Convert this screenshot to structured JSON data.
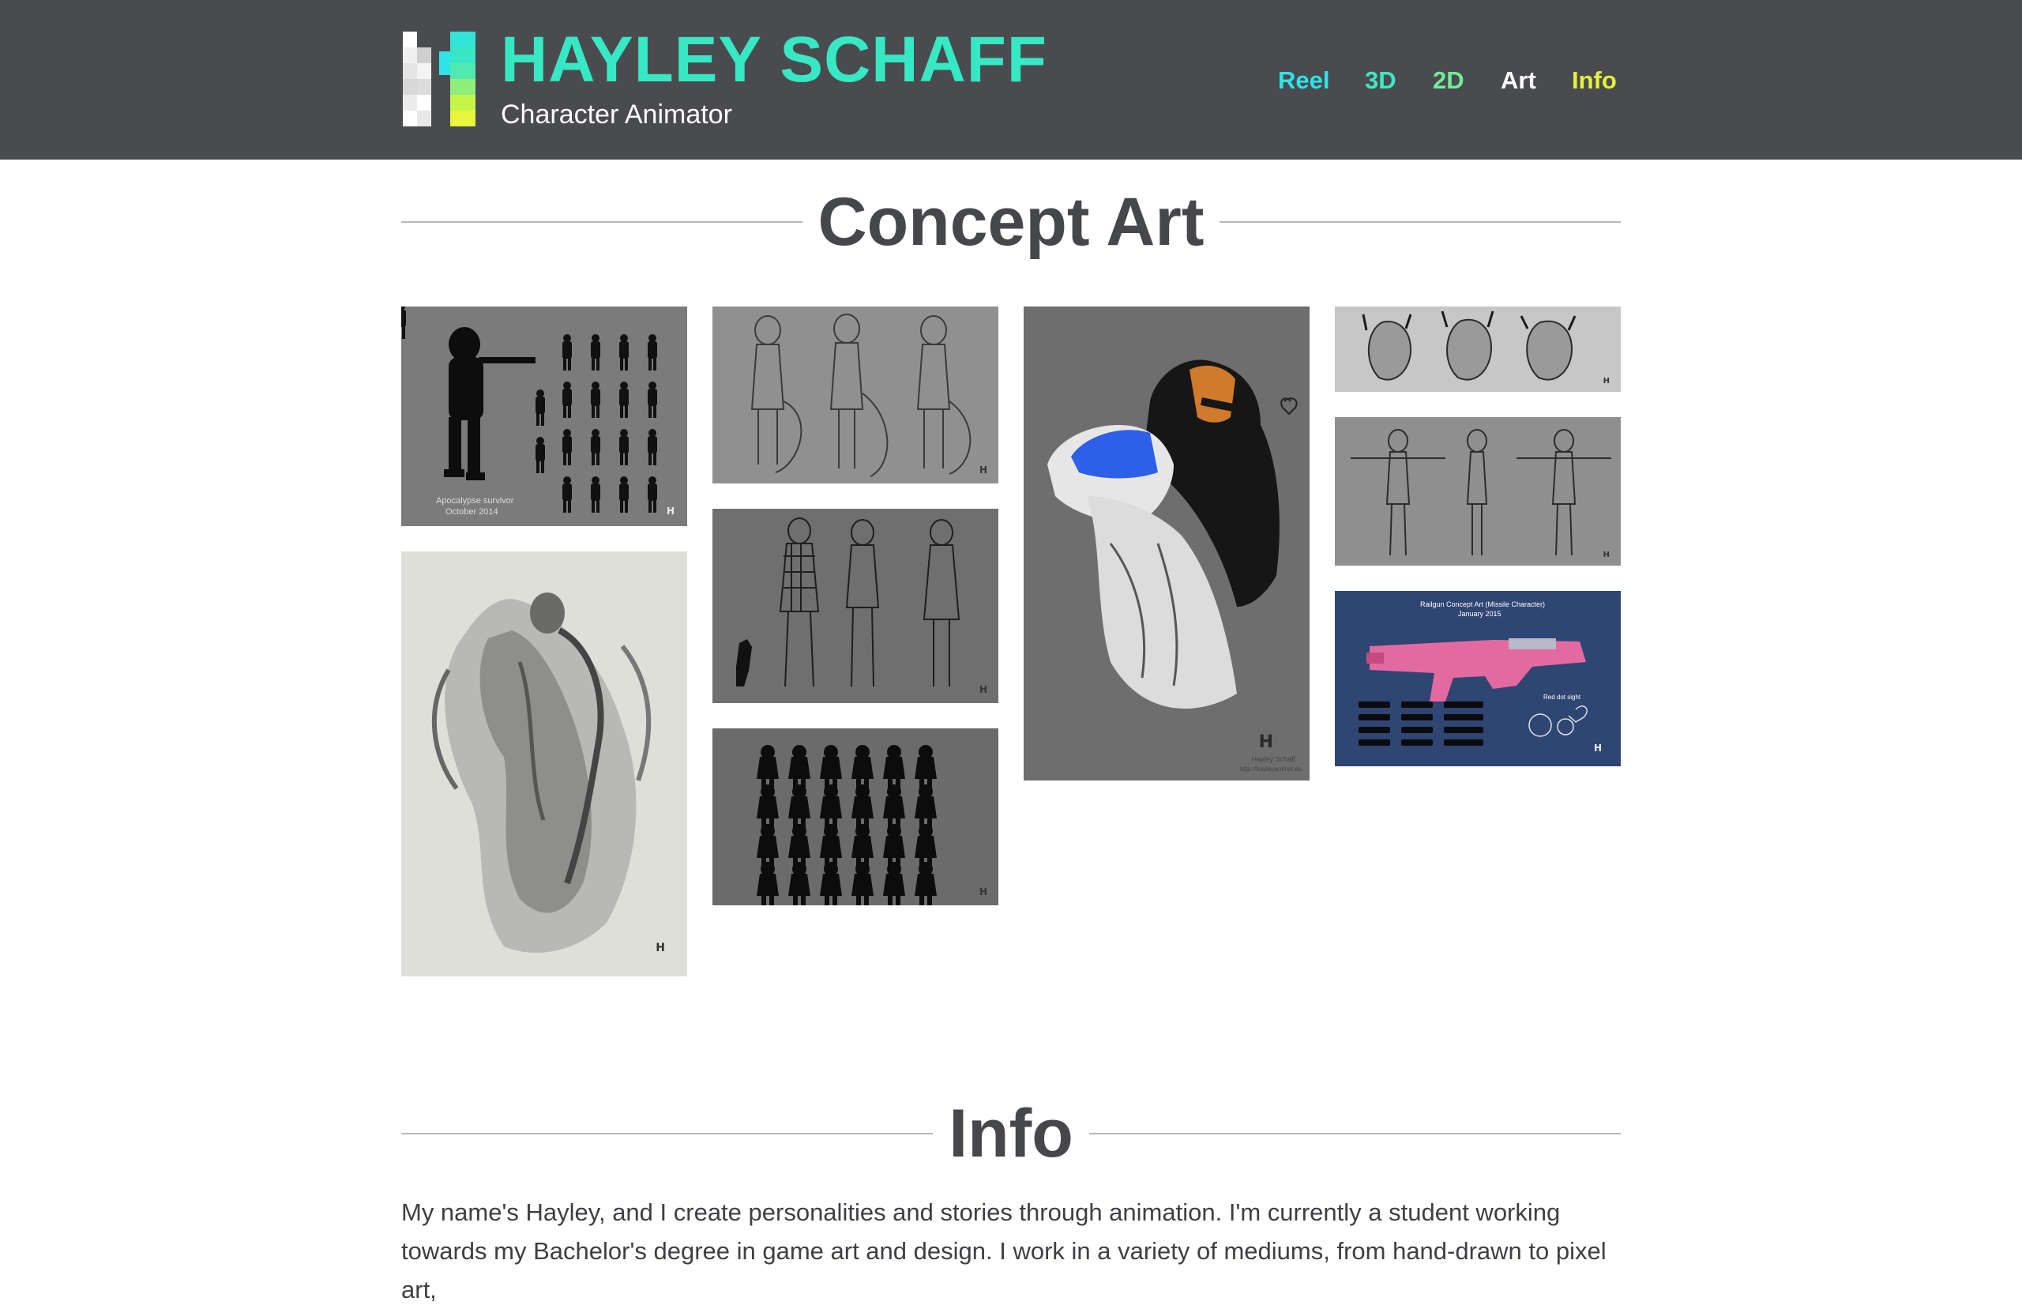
{
  "header": {
    "brand_name": "HAYLEY SCHAFF",
    "subtitle": "Character Animator",
    "nav": [
      {
        "label": "Reel",
        "color": "#2fe3e8"
      },
      {
        "label": "3D",
        "color": "#3fe7c2"
      },
      {
        "label": "2D",
        "color": "#72ec9a"
      },
      {
        "label": "Art",
        "color": "#ffffff"
      },
      {
        "label": "Info",
        "color": "#e3f23c"
      }
    ],
    "bg_color": "#4a4b4f",
    "brand_color": "#36e8c4"
  },
  "concept": {
    "title": "Concept Art",
    "gallery": [
      {
        "caption": "Apocalypse survivor",
        "caption2": "October 2014",
        "icon": "silhouette-lineup"
      },
      {
        "caption": "",
        "icon": "character-turnaround-sketch"
      },
      {
        "caption": "",
        "icon": "character-portrait-color"
      },
      {
        "caption": "",
        "icon": "head-sketches"
      },
      {
        "caption": "",
        "icon": "skeleton-embrace-drawing"
      },
      {
        "caption": "",
        "icon": "character-outfit-sketch"
      },
      {
        "caption": "",
        "icon": "character-tpose-turnaround"
      },
      {
        "caption": "",
        "icon": "creature-silhouettes"
      },
      {
        "caption": "Railgun Concept Art (Missile Character)",
        "caption2": "January 2015",
        "note": "Red dot sight",
        "icon": "railgun-design"
      }
    ],
    "watermark": {
      "author": "Hayley Schaff",
      "site": "http://hayleyanimat.es"
    }
  },
  "info": {
    "title": "Info",
    "paragraph": "My name's Hayley, and I create personalities and stories through animation. I'm currently a student working towards my Bachelor's degree in game art and design. I work in a variety of mediums, from hand-drawn to pixel art,"
  }
}
